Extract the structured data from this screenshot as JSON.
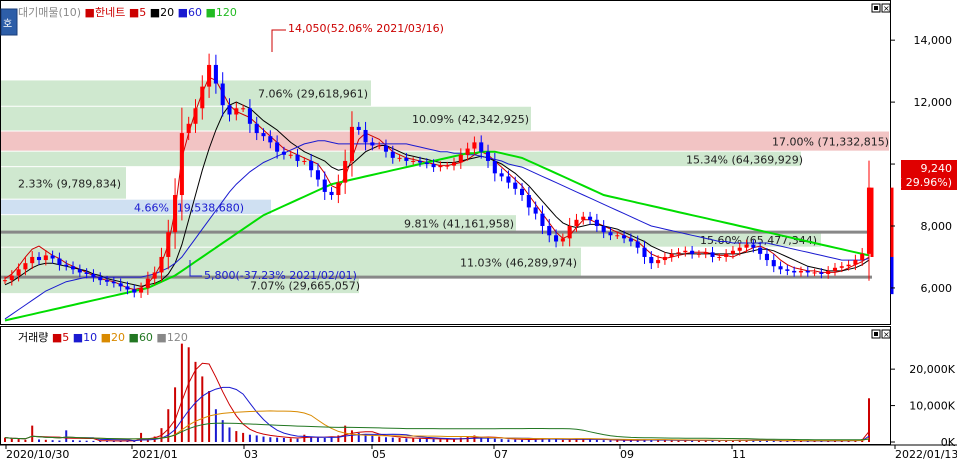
{
  "price_legend": [
    {
      "text": "대기매물(10)",
      "color": "#8a8a8a"
    },
    {
      "text": "한네트",
      "color": "#cc0000"
    },
    {
      "text": "5",
      "color": "#cc0000"
    },
    {
      "text": "20",
      "color": "#000000"
    },
    {
      "text": "60",
      "color": "#1a1ad0"
    },
    {
      "text": "120",
      "color": "#22bb22"
    }
  ],
  "side_tab": "호",
  "volume_legend": [
    {
      "text": "거래량",
      "color": "#000000"
    },
    {
      "text": "5",
      "color": "#cc0000"
    },
    {
      "text": "10",
      "color": "#1a1ad0"
    },
    {
      "text": "20",
      "color": "#d98a00"
    },
    {
      "text": "60",
      "color": "#227722"
    },
    {
      "text": "120",
      "color": "#888888"
    }
  ],
  "last_price_box": {
    "price": "9,240",
    "change": "( 29.96%)"
  },
  "annotations": {
    "high": "14,050(52.06% 2021/03/16)",
    "low": "5,800(-37.23% 2021/02/01)"
  },
  "colors": {
    "up": "#ff0000",
    "down": "#0000ff",
    "ma5": "#cc0000",
    "ma20": "#000000",
    "ma60": "#1a1ad0",
    "ma120": "#00dd00",
    "zone_green": "#cfe8cf",
    "zone_red": "#f2c4c4",
    "zone_blue": "#cfe0f2"
  },
  "chart_data": [
    {
      "type": "candlestick",
      "title": "한네트",
      "ylim": [
        4900,
        15200
      ],
      "y_ticks": [
        6000,
        8000,
        10000,
        12000,
        14000
      ],
      "y_tick_labels": [
        "6,000",
        "8,000",
        "10,000",
        "12,000",
        "14,000"
      ],
      "x_tick_labels": [
        "2020/10/30",
        "2021/01",
        "03",
        "05",
        "07",
        "09",
        "11",
        "2022/01/13"
      ],
      "last_price": 9240,
      "horizontal_lines": [
        7800,
        6350
      ],
      "volume_profile": [
        {
          "label": "7.07% (29,665,057)",
          "low": 5800,
          "high": 6350,
          "color": "green"
        },
        {
          "label": "11.03% (46,289,974)",
          "low": 6350,
          "high": 7300,
          "color": "green"
        },
        {
          "label": "15.60% (65,477,344)",
          "low": 7300,
          "high": 7800,
          "color": "green"
        },
        {
          "label": "9.81% (41,161,958)",
          "low": 7800,
          "high": 8350,
          "color": "green"
        },
        {
          "label": "4.66% (19,538,680)",
          "low": 8350,
          "high": 8850,
          "color": "blue"
        },
        {
          "label": "2.33% (9,789,834)",
          "low": 8850,
          "high": 9900,
          "color": "green"
        },
        {
          "label": "15.34% (64,369,929)",
          "low": 9900,
          "high": 10400,
          "color": "green"
        },
        {
          "label": "17.00% (71,332,815)",
          "low": 10400,
          "high": 11050,
          "color": "red"
        },
        {
          "label": "10.09% (42,342,925)",
          "low": 11050,
          "high": 11850,
          "color": "green"
        },
        {
          "label": "7.06% (29,618,961)",
          "low": 11850,
          "high": 12700,
          "color": "green"
        }
      ],
      "series": [
        {
          "name": "5",
          "values": [
            6300,
            6450,
            6700,
            7000,
            7250,
            7350,
            7200,
            7050,
            6950,
            6800,
            6700,
            6600,
            6500,
            6400,
            6300,
            6250,
            6200,
            6100,
            6000,
            5950,
            6000,
            6150,
            6400,
            6800,
            7400,
            8500,
            10200,
            11000,
            11700,
            12300,
            12800,
            12700,
            12300,
            11900,
            11700,
            11600,
            11500,
            11300,
            11100,
            10900,
            10700,
            10500,
            10400,
            10300,
            10200,
            10100,
            10000,
            9700,
            9300,
            9200,
            9600,
            10200,
            10800,
            11000,
            10900,
            10800,
            10600,
            10400,
            10300,
            10200,
            10150,
            10100,
            10050,
            10000,
            9950,
            9950,
            10000,
            10050,
            10150,
            10300,
            10400,
            10300,
            10100,
            9900,
            9700,
            9500,
            9300,
            9000,
            8700,
            8400,
            8100,
            7800,
            7600,
            7700,
            7950,
            8200,
            8200,
            8100,
            8000,
            7900,
            7800,
            7700,
            7600,
            7500,
            7300,
            7100,
            7000,
            6950,
            7000,
            7050,
            7100,
            7150,
            7150,
            7150,
            7100,
            7050,
            7050,
            7000,
            7100,
            7200,
            7300,
            7350,
            7250,
            7100,
            6900,
            6750,
            6650,
            6600,
            6550,
            6550,
            6500,
            6500,
            6500,
            6550,
            6650,
            6750,
            6850,
            7000
          ]
        },
        {
          "name": "20",
          "values": [
            6100,
            6200,
            6350,
            6500,
            6650,
            6750,
            6800,
            6800,
            6750,
            6700,
            6650,
            6600,
            6550,
            6450,
            6400,
            6300,
            6250,
            6200,
            6150,
            6100,
            6050,
            6100,
            6150,
            6250,
            6450,
            6800,
            7400,
            8200,
            9000,
            9800,
            10500,
            11100,
            11600,
            11900,
            12000,
            11900,
            11800,
            11600,
            11400,
            11250,
            11100,
            10900,
            10700,
            10550,
            10400,
            10300,
            10200,
            10100,
            9900,
            9800,
            9850,
            10000,
            10200,
            10400,
            10500,
            10600,
            10600,
            10500,
            10400,
            10300,
            10250,
            10200,
            10150,
            10100,
            10050,
            10050,
            10050,
            10100,
            10150,
            10200,
            10250,
            10200,
            10100,
            10000,
            9850,
            9700,
            9500,
            9300,
            9050,
            8800,
            8550,
            8300,
            8100,
            8000,
            7950,
            8000,
            8050,
            8050,
            8000,
            7950,
            7900,
            7800,
            7700,
            7600,
            7500,
            7350,
            7250,
            7150,
            7100,
            7100,
            7100,
            7100,
            7100,
            7100,
            7100,
            7100,
            7100,
            7100,
            7100,
            7150,
            7200,
            7250,
            7250,
            7200,
            7100,
            7000,
            6900,
            6800,
            6700,
            6650,
            6600,
            6550,
            6550,
            6550,
            6600,
            6650,
            6750,
            6900
          ]
        },
        {
          "name": "60",
          "values": [
            5000,
            5150,
            5300,
            5450,
            5600,
            5750,
            5900,
            6000,
            6100,
            6200,
            6250,
            6300,
            6350,
            6350,
            6350,
            6350,
            6350,
            6350,
            6350,
            6350,
            6350,
            6400,
            6450,
            6550,
            6650,
            6800,
            7000,
            7300,
            7600,
            7900,
            8200,
            8500,
            8800,
            9100,
            9350,
            9550,
            9750,
            9900,
            10050,
            10150,
            10250,
            10350,
            10450,
            10550,
            10650,
            10700,
            10750,
            10750,
            10700,
            10650,
            10650,
            10650,
            10650,
            10650,
            10650,
            10650,
            10650,
            10650,
            10650,
            10650,
            10600,
            10550,
            10500,
            10450,
            10400,
            10400,
            10350,
            10350,
            10300,
            10300,
            10250,
            10200,
            10150,
            10100,
            10000,
            9950,
            9900,
            9800,
            9700,
            9600,
            9500,
            9400,
            9300,
            9200,
            9100,
            9000,
            8900,
            8800,
            8700,
            8600,
            8500,
            8400,
            8300,
            8200,
            8100,
            8000,
            7950,
            7900,
            7850,
            7800,
            7750,
            7700,
            7650,
            7600,
            7550,
            7500,
            7500,
            7450,
            7450,
            7450,
            7450,
            7450,
            7450,
            7400,
            7350,
            7300,
            7250,
            7200,
            7150,
            7100,
            7050,
            7000,
            6950,
            6900,
            6900,
            6900,
            6900,
            6950
          ]
        },
        {
          "name": "120",
          "values": [
            4950,
            5000,
            5050,
            5100,
            5150,
            5200,
            5250,
            5300,
            5350,
            5400,
            5450,
            5500,
            5550,
            5600,
            5650,
            5700,
            5750,
            5800,
            5850,
            5900,
            5950,
            6000,
            6100,
            6200,
            6300,
            6400,
            6550,
            6700,
            6850,
            7000,
            7150,
            7300,
            7450,
            7600,
            7750,
            7900,
            8050,
            8200,
            8350,
            8450,
            8550,
            8650,
            8750,
            8850,
            8950,
            9050,
            9150,
            9250,
            9350,
            9400,
            9450,
            9500,
            9550,
            9600,
            9650,
            9700,
            9750,
            9800,
            9850,
            9900,
            9950,
            10000,
            10050,
            10100,
            10150,
            10200,
            10250,
            10300,
            10350,
            10350,
            10400,
            10400,
            10400,
            10350,
            10300,
            10250,
            10200,
            10100,
            10000,
            9900,
            9800,
            9700,
            9600,
            9500,
            9400,
            9300,
            9200,
            9100,
            9000,
            8950,
            8900,
            8850,
            8800,
            8750,
            8700,
            8650,
            8600,
            8550,
            8500,
            8450,
            8400,
            8350,
            8300,
            8250,
            8200,
            8150,
            8100,
            8050,
            8000,
            7950,
            7900,
            7850,
            7800,
            7750,
            7700,
            7650,
            7600,
            7550,
            7500,
            7450,
            7400,
            7350,
            7300,
            7250,
            7200,
            7150,
            7100,
            7050
          ]
        }
      ],
      "candles": [
        6250,
        6400,
        6600,
        6800,
        7000,
        6900,
        7050,
        6950,
        6750,
        6700,
        6600,
        6500,
        6450,
        6350,
        6250,
        6200,
        6150,
        6050,
        5950,
        5850,
        6000,
        6300,
        6500,
        7000,
        7800,
        9000,
        11000,
        11300,
        11800,
        12500,
        13200,
        12600,
        11900,
        11600,
        11800,
        11800,
        11300,
        11000,
        10900,
        10700,
        10400,
        10300,
        10300,
        10100,
        10100,
        9800,
        9500,
        9100,
        9000,
        9400,
        10100,
        11200,
        11100,
        10700,
        10600,
        10600,
        10400,
        10200,
        10200,
        10100,
        10100,
        10050,
        10000,
        9900,
        9950,
        9950,
        10050,
        10300,
        10500,
        10700,
        10400,
        10100,
        9700,
        9600,
        9400,
        9200,
        9000,
        8600,
        8400,
        8000,
        7700,
        7500,
        7600,
        8000,
        8200,
        8300,
        8200,
        8000,
        7800,
        7700,
        7700,
        7600,
        7500,
        7300,
        7000,
        6800,
        6900,
        7000,
        7100,
        7150,
        7200,
        7100,
        7100,
        7150,
        7000,
        7000,
        7100,
        7200,
        7300,
        7400,
        7300,
        7100,
        6900,
        6700,
        6600,
        6550,
        6500,
        6550,
        6500,
        6500,
        6450,
        6550,
        6650,
        6700,
        6750,
        6900,
        7100,
        9240
      ]
    },
    {
      "type": "bar",
      "title": "거래량",
      "ylim": [
        0,
        28000
      ],
      "y_ticks": [
        0,
        10000,
        20000
      ],
      "y_tick_labels": [
        "0K",
        "10,000K",
        "20,000K"
      ],
      "x_tick_labels": [
        "2020/10/30",
        "2021/01",
        "03",
        "05",
        "07",
        "09",
        "11",
        "2022/01/13"
      ],
      "values": [
        1200,
        900,
        800,
        600,
        4500,
        700,
        600,
        500,
        400,
        3200,
        500,
        400,
        350,
        300,
        300,
        250,
        300,
        250,
        350,
        400,
        2500,
        900,
        1500,
        3800,
        9000,
        15000,
        27000,
        26000,
        22000,
        18000,
        14000,
        9000,
        6000,
        4000,
        3000,
        2500,
        2000,
        1800,
        1500,
        1300,
        1200,
        1100,
        1000,
        900,
        2000,
        1500,
        1200,
        1100,
        1300,
        1800,
        4500,
        3200,
        2500,
        2000,
        1800,
        1500,
        1300,
        1200,
        1100,
        1000,
        950,
        900,
        850,
        800,
        750,
        700,
        800,
        1200,
        1500,
        1800,
        1300,
        1100,
        900,
        800,
        700,
        650,
        600,
        700,
        900,
        1100,
        800,
        700,
        600,
        700,
        900,
        800,
        700,
        600,
        500,
        500,
        450,
        400,
        500,
        600,
        700,
        600,
        500,
        450,
        400,
        400,
        400,
        500,
        450,
        400,
        400,
        350,
        400,
        500,
        600,
        500,
        450,
        400,
        350,
        350,
        300,
        300,
        300,
        300,
        300,
        300,
        300,
        350,
        400,
        400,
        500,
        600,
        800,
        12000
      ]
    }
  ]
}
